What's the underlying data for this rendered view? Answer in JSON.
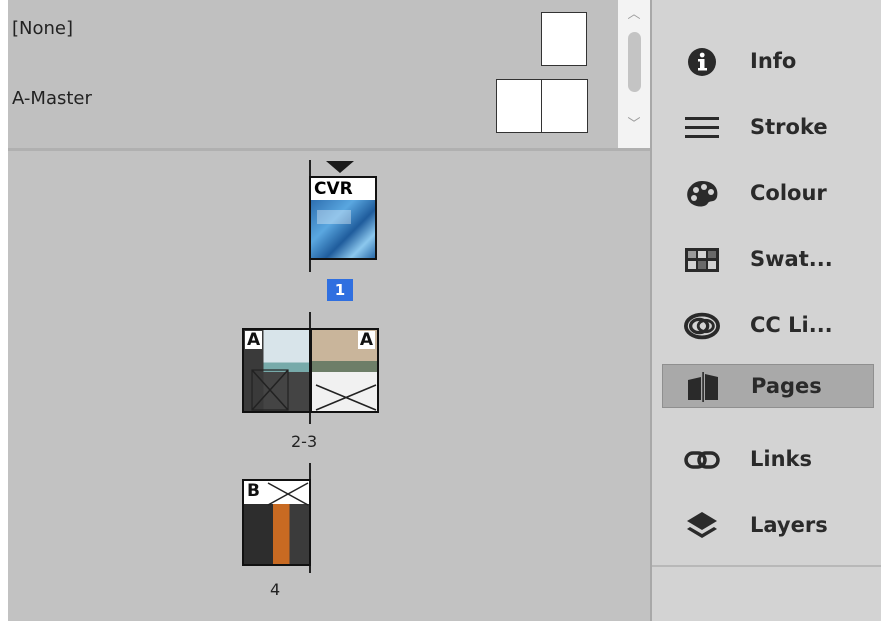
{
  "masters": {
    "none_label": "[None]",
    "a_master_label": "A-Master"
  },
  "pages": {
    "cover_label": "CVR",
    "page1_number": "1",
    "spread_left_letter": "A",
    "spread_right_letter": "A",
    "spread_label": "2-3",
    "page4_letter": "B",
    "page4_label": "4"
  },
  "dock": {
    "items": [
      {
        "label": "Info",
        "icon": "info-icon"
      },
      {
        "label": "Stroke",
        "icon": "stroke-icon"
      },
      {
        "label": "Colour",
        "icon": "palette-icon"
      },
      {
        "label": "Swat...",
        "icon": "swatches-icon"
      },
      {
        "label": "CC Li...",
        "icon": "cc-libraries-icon"
      },
      {
        "label": "Pages",
        "icon": "pages-icon",
        "active": true
      },
      {
        "label": "Links",
        "icon": "links-icon"
      },
      {
        "label": "Layers",
        "icon": "layers-icon"
      }
    ]
  },
  "colors": {
    "page_number_highlight": "#2f6fe0",
    "panel_bg": "#c2c2c2",
    "dock_bg": "#d3d3d3"
  }
}
